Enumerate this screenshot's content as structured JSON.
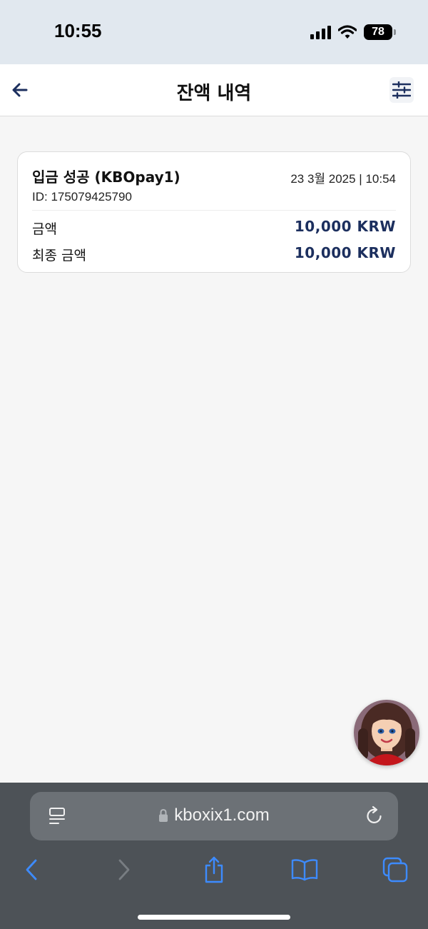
{
  "status_bar": {
    "time": "10:55",
    "battery": "78"
  },
  "header": {
    "title": "잔액 내역"
  },
  "transaction": {
    "title": "입금 성공 (KBOpay1)",
    "datetime": "23 3월 2025 | 10:54",
    "id_text": "ID: 175079425790",
    "rows": [
      {
        "label": "금액",
        "value": "10,000 KRW"
      },
      {
        "label": "최종 금액",
        "value": "10,000 KRW"
      }
    ]
  },
  "browser": {
    "url": "kboxix1.com"
  },
  "colors": {
    "accent": "#1c2f5e",
    "browser_blue": "#3d8bff",
    "status_bg": "#e1e8ef",
    "browser_bg": "#4d5257"
  }
}
